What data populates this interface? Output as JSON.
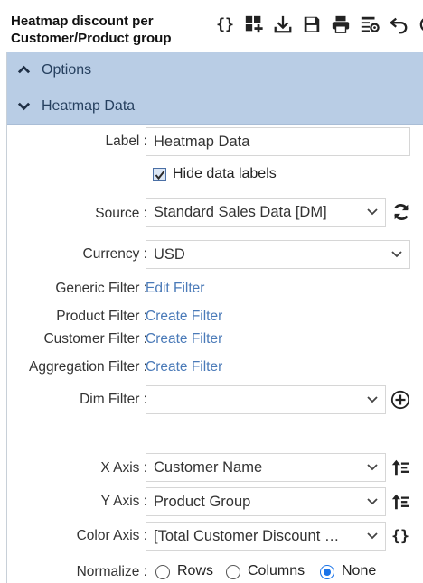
{
  "header": {
    "title_line1": "Heatmap discount per",
    "title_line2": "Customer/Product group"
  },
  "toolbar": {
    "buttons": [
      "braces-icon",
      "add-widget-icon",
      "download-icon",
      "save-icon",
      "print-icon",
      "settings-icon",
      "undo-icon",
      "refresh-icon"
    ]
  },
  "sections": {
    "options": "Options",
    "heatmap": "Heatmap Data"
  },
  "form": {
    "label_label": "Label :",
    "label_value": "Heatmap Data",
    "hide_labels": "Hide data labels",
    "hide_labels_checked": true,
    "source_label": "Source :",
    "source_value": "Standard Sales Data [DM]",
    "currency_label": "Currency :",
    "currency_value": "USD",
    "generic_filter_label": "Generic Filter :",
    "generic_filter_link": "Edit Filter",
    "product_filter_label": "Product Filter :",
    "product_filter_link": "Create Filter",
    "customer_filter_label": "Customer Filter :",
    "customer_filter_link": "Create Filter",
    "aggregation_filter_label": "Aggregation Filter :",
    "aggregation_filter_link": "Create Filter",
    "dim_filter_label": "Dim Filter :",
    "dim_filter_value": "",
    "x_axis_label": "X Axis :",
    "x_axis_value": "Customer Name",
    "y_axis_label": "Y Axis :",
    "y_axis_value": "Product Group",
    "color_axis_label": "Color Axis :",
    "color_axis_value": "[Total Customer Discount …",
    "normalize_label": "Normalize :",
    "normalize_options": [
      "Rows",
      "Columns",
      "None"
    ],
    "normalize_selected": "None"
  },
  "colors": {
    "section_bg": "#b9cde5",
    "link": "#4a7ab8",
    "radio_active": "#1a73e8"
  }
}
